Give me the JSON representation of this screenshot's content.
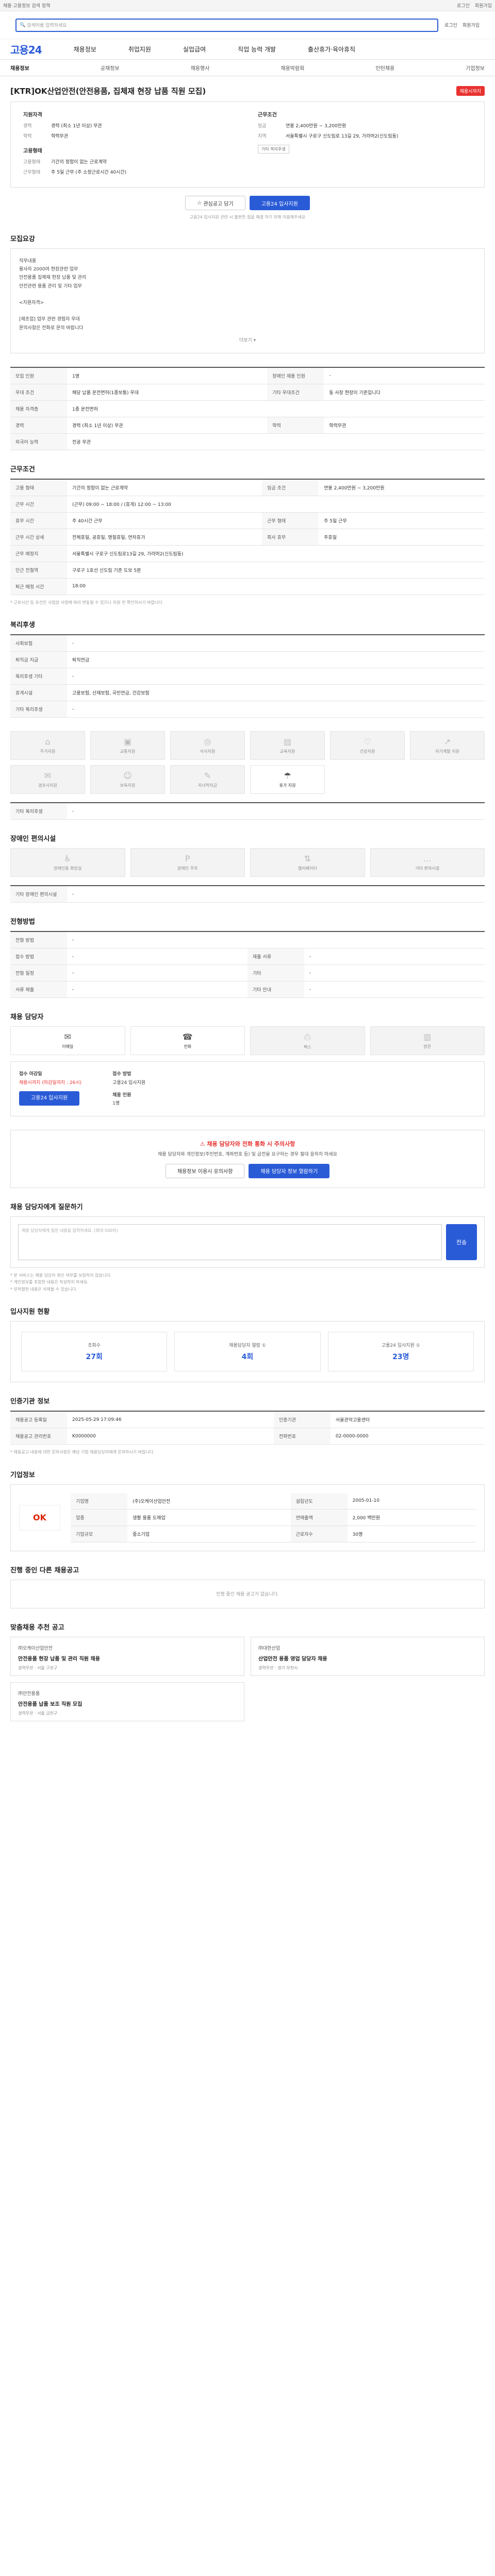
{
  "top": {
    "left": "채용·고용정보 검색 정책",
    "links": [
      "로그인",
      "회원가입"
    ]
  },
  "search": {
    "placeholder": "검색어를 입력하세요",
    "util": [
      "로그인",
      "회원가입"
    ]
  },
  "gnb": {
    "logo": "고용24",
    "menus": [
      "채용정보",
      "취업지원",
      "실업급여",
      "직업 능력 개발",
      "출산휴가·육아휴직"
    ]
  },
  "subnav": {
    "items": [
      "채용정보",
      "공채정보",
      "채용행사",
      "채용박람회",
      "인턴채용",
      "기업정보"
    ]
  },
  "job": {
    "title": "[KTR]OK산업안전(안전용품, 집체재 현장 납품 직원 모집)",
    "badge": "채용시까지",
    "recruit_h": "지원자격",
    "cond_h": "근무조건",
    "left": [
      {
        "k": "경력",
        "v": "경력 (최소 1년 이상) 무관"
      },
      {
        "k": "학력",
        "v": "학력무관"
      }
    ],
    "right": [
      {
        "k": "임금",
        "v": "연봉 2,400만원 ~ 3,200만원"
      },
      {
        "k": "지역",
        "v": "서울특별시 구로구 신도림로 13길 29, 가라머2(신도림동)"
      }
    ],
    "employ_h": "고용형태",
    "employ": [
      {
        "k": "고용형태",
        "v": "기간의 정함이 없는 근로계약"
      },
      {
        "k": "근무형태",
        "v": "주 5일 근무 (주 소정근로시간 40시간)"
      }
    ],
    "tag": "기타 복리후생",
    "btn_scrap": "관심공고 담기",
    "btn_apply": "고용24 입사지원",
    "notice": "고용24 입사지원 관련 시 불편한 점을 해결 하기 위해 이용해주세요"
  },
  "detail": {
    "h": "모집요강",
    "lines": [
      "직무내용",
      "용사자 2000여 현장관련 업무",
      "안전용품 집체재 현장 납품 및 관리",
      "안전관련 용품 관리 및 기타 업무",
      "",
      "<지원자격>",
      "",
      "[제조업] 업무 관련 경험자 우대",
      "문의사항은 전화로 문의 바랍니다"
    ],
    "more": "더보기"
  },
  "req": {
    "rows": [
      [
        "모집 인원",
        "1명",
        "장애인 채용 인원",
        "-"
      ],
      [
        "우대 조건",
        "해당 납품 운전면허(1종보통) 우대",
        "기타 우대조건",
        "동 사장 현장이 기준입니다"
      ],
      [
        "채용 자격증",
        "1종 운전면허",
        "",
        ""
      ],
      [
        "경력",
        "경력 (최소 1년 이상) 무관",
        "학력",
        "학력무관"
      ],
      [
        "외국어 능력",
        "전공 무관",
        "",
        ""
      ]
    ]
  },
  "cond": {
    "h": "근무조건",
    "rows": [
      [
        "고용 형태",
        "기간의 정함이 없는 근로계약",
        "임금 조건",
        "연봉 2,400만원 ~ 3,200만원"
      ],
      [
        "근무 시간",
        "(근무) 09:00 ~ 18:00 / (휴게) 12:00 ~ 13:00",
        "",
        ""
      ],
      [
        "휴무 시간",
        "주 40시간 근무",
        "근무 형태",
        "주 5일 근무"
      ],
      [
        "근무 시간 상세",
        "전체휴일, 공휴일, 명절휴일, 연차휴가",
        "회사 휴무",
        "주휴일"
      ],
      [
        "근무 예정지",
        "서울특별시 구로구 신도림로13길 29, 가라머2(신도림동)",
        "",
        ""
      ],
      [
        "인근 전철역",
        "구로구 1호선 신도림 기준 도보 5분",
        "",
        ""
      ],
      [
        "퇴근 예정 시간",
        "18:00",
        "",
        ""
      ]
    ],
    "note": "* 근로시간 등 조건은 사업장 사정에 따라 변동될 수 있으니 지원 전 확인하시기 바랍니다."
  },
  "welfare": {
    "h": "복리후생",
    "rows": [
      [
        "사회보험",
        "-"
      ],
      [
        "퇴직금 지급",
        "퇴직연금"
      ],
      [
        "복리후생 기타",
        "-"
      ],
      [
        "휴게시설",
        "고용보험, 산재보험, 국민연금, 건강보험"
      ],
      [
        "기타 복리후생",
        "-"
      ]
    ],
    "items": [
      "주거지원",
      "교통지원",
      "식사지원",
      "교육지원",
      "건강지원",
      "자기계발 지원",
      "경조사지원",
      "보육지원",
      "자녀학자금",
      "휴가 지원",
      "기타 복지",
      "법정 수당"
    ],
    "more_h": "기타 복리후생",
    "more_v": "-"
  },
  "disabled": {
    "h": "장애인 편의시설",
    "items": [
      "장애인용 화장실",
      "장애인 주차",
      "엘리베이터",
      "기타 편의시설"
    ],
    "more_h": "기타 장애인 편의시설",
    "more_v": "-"
  },
  "process": {
    "h": "전형방법",
    "rows": [
      [
        "전형 방법",
        "-",
        "",
        ""
      ],
      [
        "접수 방법",
        "-",
        "제출 서류",
        "-"
      ],
      [
        "전형 일정",
        "-",
        "기타",
        "-"
      ],
      [
        "서류 제출",
        "-",
        "기타 안내",
        "-"
      ]
    ]
  },
  "contact": {
    "h": "채용 담당자",
    "items": [
      "이메일",
      "전화",
      "팩스",
      "방문"
    ],
    "apply_h": "접수 마감일",
    "apply_v": "채용시까지 (마감일까지 : 26시)",
    "method_h": "접수 방법",
    "method_v": "고용24 입사지원",
    "people_h": "채용 인원",
    "people_v": "1명",
    "btn": "고용24 입사지원"
  },
  "alert": {
    "t": "채용 담당자와 전화 통화 시 주의사항",
    "d": "채용 담당자와 개인정보(주민번호, 계좌번호 등) 및 금전을 요구하는 경우 절대 응하지 마세요",
    "b1": "채용정보 이용시 유의사항",
    "b2": "채용 담당자 정보 열람하기"
  },
  "qa": {
    "h": "채용 담당자에게 질문하기",
    "ph": "채용 담당자에게 질문 내용을 입력하세요. (최대 500자)",
    "send": "전송",
    "notes": [
      "* 본 서비스는 채용 담당자 회신 여부를 보장하지 않습니다.",
      "* 개인정보를 포함한 내용은 작성하지 마세요.",
      "* 부적절한 내용은 삭제될 수 있습니다."
    ]
  },
  "stats": {
    "h": "입사지원 현황",
    "items": [
      {
        "l": "조회수",
        "n": "27회"
      },
      {
        "l": "채용담당자 열람 ①",
        "n": "4회"
      },
      {
        "l": "고용24 입사지원 ①",
        "n": "23명"
      }
    ]
  },
  "info": {
    "h": "인증기관 정보",
    "rows": [
      [
        "채용공고 등록일",
        "2025-05-29 17:09:46",
        "인증기관",
        "서울관악고용센터"
      ],
      [
        "채용공고 관리번호",
        "K0000000",
        "전화번호",
        "02-0000-0000"
      ]
    ],
    "note": "* 채용공고 내용에 대한 문의사항은 해당 기업 채용담당자에게 문의하시기 바랍니다."
  },
  "company": {
    "h": "기업정보",
    "logo": "OK",
    "rows": [
      [
        "기업명",
        "(주)오케이산업안전"
      ],
      [
        "업종",
        "생활 용품 도매업"
      ],
      [
        "기업규모",
        "중소기업"
      ],
      [
        "설립년도",
        "2005-01-10"
      ],
      [
        "연매출액",
        "2,000 백만원"
      ],
      [
        "근로자수",
        "30명"
      ]
    ]
  },
  "recent": {
    "h": "진행 중인 다른 채용공고",
    "empty": "진행 중인 채용 공고가 없습니다."
  },
  "similar": {
    "h": "맞춤채용 추천 공고",
    "cards": [
      {
        "co": "㈜오케이산업안전",
        "tt": "안전용품 현장 납품 및 관리 직원 채용",
        "meta": "경력무관 · 서울 구로구"
      },
      {
        "co": "㈜대한산업",
        "tt": "산업안전 용품 영업 담당자 채용",
        "meta": "경력무관 · 경기 부천시"
      },
      {
        "co": "㈜안전용품",
        "tt": "안전용품 납품 보조 직원 모집",
        "meta": "경력무관 · 서울 금천구"
      }
    ]
  }
}
